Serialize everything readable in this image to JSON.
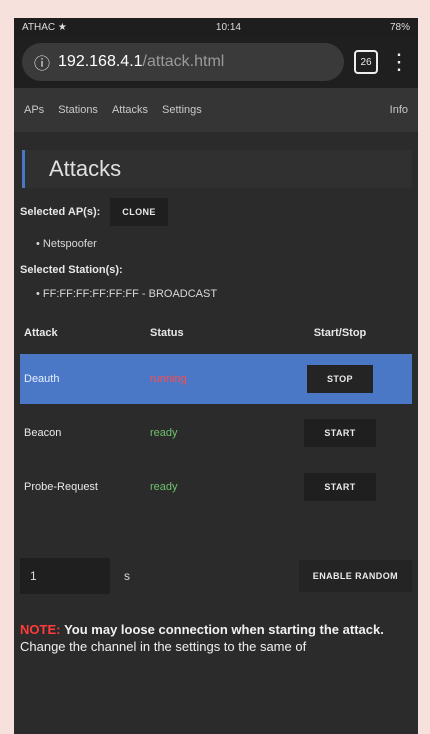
{
  "statusbar": {
    "left": "ATHAC ★",
    "time": "10:14",
    "right": "78%"
  },
  "browser": {
    "url_host": "192.168.4.1",
    "url_path": "/attack.html",
    "tabs_count": "26"
  },
  "nav": {
    "items": [
      "APs",
      "Stations",
      "Attacks",
      "Settings"
    ],
    "info": "Info"
  },
  "page": {
    "title": "Attacks",
    "selected_ap_label": "Selected AP(s):",
    "clone_label": "CLONE",
    "selected_ap": "Netspoofer",
    "selected_station_label": "Selected Station(s):",
    "selected_station": "FF:FF:FF:FF:FF:FF - BROADCAST"
  },
  "table": {
    "headers": [
      "Attack",
      "Status",
      "Start/Stop"
    ],
    "rows": [
      {
        "attack": "Deauth",
        "status": "running",
        "action": "STOP",
        "status_color": "#ff4a4a"
      },
      {
        "attack": "Beacon",
        "status": "ready",
        "action": "START",
        "status_color": "#6ec16e"
      },
      {
        "attack": "Probe-Request",
        "status": "ready",
        "action": "START",
        "status_color": "#6ec16e"
      }
    ]
  },
  "controls": {
    "random_interval_value": "1",
    "random_interval_unit": "s",
    "enable_random_label": "ENABLE RANDOM"
  },
  "note": {
    "prefix": "NOTE:",
    "line1": "You may loose connection when starting the attack.",
    "line2": "Change the channel in the settings to the same of"
  },
  "colors": {
    "accent_blue": "#4a78c7",
    "stop_red": "#ff4a4a",
    "ready_green": "#6ec16e"
  }
}
